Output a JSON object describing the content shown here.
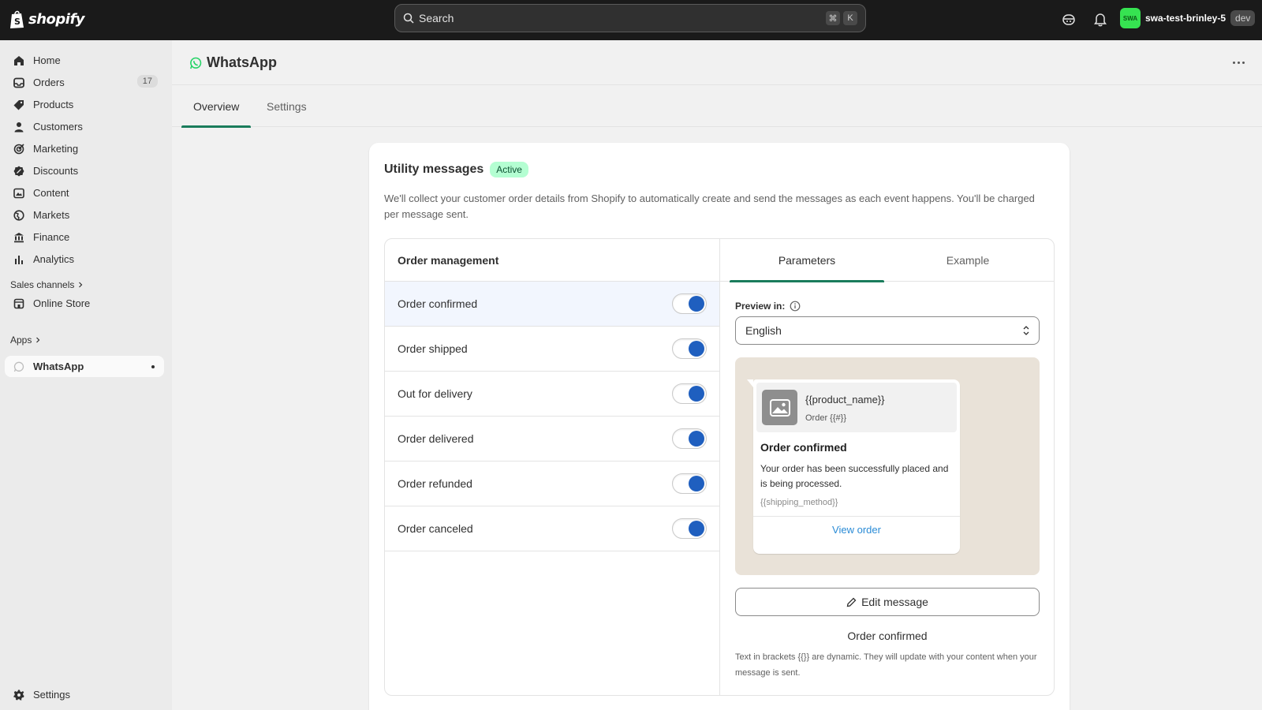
{
  "brand": {
    "logo_text": "shopify"
  },
  "search": {
    "placeholder": "Search",
    "shortcut_cmd": "⌘",
    "shortcut_key": "K"
  },
  "store": {
    "avatar_text": "SWA",
    "name": "swa-test-brinley-5",
    "badge": "dev"
  },
  "sidebar": {
    "items": [
      {
        "label": "Home",
        "icon": "home-icon"
      },
      {
        "label": "Orders",
        "icon": "inbox-icon",
        "badge": "17"
      },
      {
        "label": "Products",
        "icon": "tag-icon"
      },
      {
        "label": "Customers",
        "icon": "person-icon"
      },
      {
        "label": "Marketing",
        "icon": "target-icon"
      },
      {
        "label": "Discounts",
        "icon": "discount-icon"
      },
      {
        "label": "Content",
        "icon": "content-icon"
      },
      {
        "label": "Markets",
        "icon": "globe-icon"
      },
      {
        "label": "Finance",
        "icon": "bank-icon"
      },
      {
        "label": "Analytics",
        "icon": "chart-icon"
      }
    ],
    "sales_channels_label": "Sales channels",
    "online_store": "Online Store",
    "apps_label": "Apps",
    "whatsapp": "WhatsApp",
    "settings": "Settings"
  },
  "page": {
    "title": "WhatsApp"
  },
  "tabs": [
    {
      "label": "Overview"
    },
    {
      "label": "Settings"
    }
  ],
  "card": {
    "title": "Utility messages",
    "status": "Active",
    "description": "We'll collect your customer order details from Shopify to automatically create and send the messages as each event happens. You'll be charged per message sent.",
    "list_title": "Order management",
    "events": [
      {
        "label": "Order confirmed",
        "enabled": true
      },
      {
        "label": "Order shipped",
        "enabled": true
      },
      {
        "label": "Out for delivery",
        "enabled": true
      },
      {
        "label": "Order delivered",
        "enabled": true
      },
      {
        "label": "Order refunded",
        "enabled": true
      },
      {
        "label": "Order canceled",
        "enabled": true
      }
    ],
    "right_tabs": [
      {
        "label": "Parameters"
      },
      {
        "label": "Example"
      }
    ],
    "preview_label": "Preview in:",
    "language": "English",
    "message": {
      "product_name": "{{product_name}}",
      "order_ref": "Order {{#}}",
      "title": "Order confirmed",
      "body": "Your order has been successfully placed and is being processed.",
      "footer": "{{shipping_method}}",
      "link": "View order"
    },
    "edit_button": "Edit message",
    "caption": "Order confirmed",
    "help_text": "Text in brackets {{}} are dynamic. They will update with your content when your message is sent."
  },
  "colors": {
    "accent": "#1a7c5c",
    "toggle": "#1f5fbf",
    "active_badge": "#b4fed2",
    "whatsapp": "#25d366"
  }
}
